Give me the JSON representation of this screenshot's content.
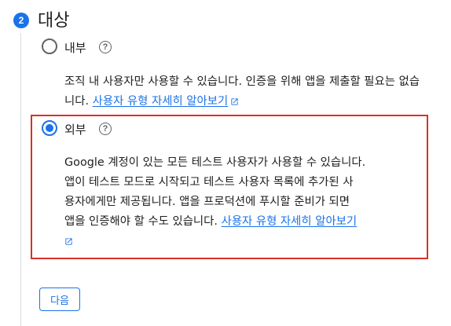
{
  "step": {
    "number": "2",
    "title": "대상"
  },
  "options": {
    "internal": {
      "label": "내부",
      "selected": false,
      "description": "조직 내 사용자만 사용할 수 있습니다. 인증을 위해 앱을 제출할 필요는 없습니다.",
      "link": "사용자 유형 자세히 알아보기"
    },
    "external": {
      "label": "외부",
      "selected": true,
      "description_lines": [
        "Google 계정이 있는 모든 테스트 사용자가 사용할 수 있습니다.",
        "앱이 테스트 모드로 시작되고 테스트 사용자 목록에 추가된 사",
        "용자에게만 제공됩니다. 앱을 프로덕션에 푸시할 준비가 되면",
        "앱을 인증해야 할 수도 있습니다."
      ],
      "link": "사용자 유형 자세히 알아보기"
    }
  },
  "help_icon_glyph": "?",
  "next_button": "다음",
  "colors": {
    "accent": "#1a73e8",
    "highlight": "#d93025",
    "text": "#202124",
    "muted": "#5f6368"
  },
  "icons": {
    "help": "help-icon",
    "external_link": "external-link-icon"
  }
}
